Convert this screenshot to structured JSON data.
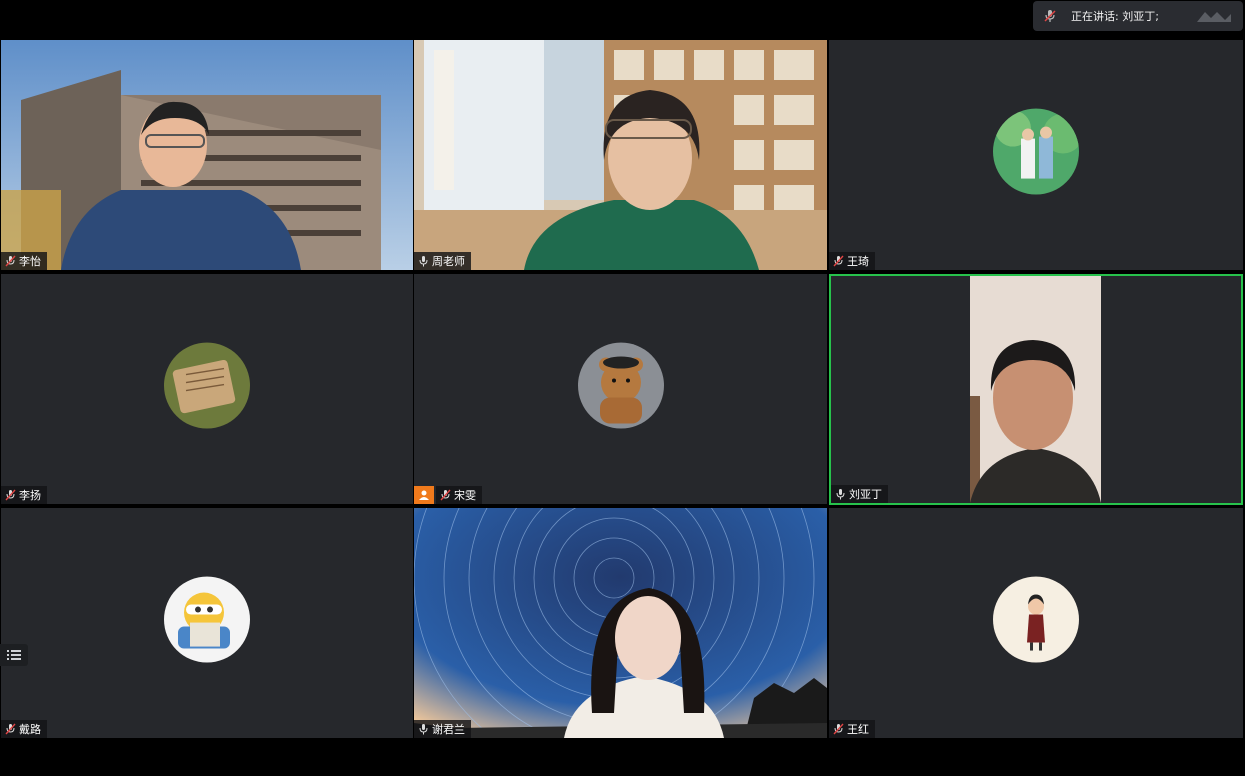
{
  "speaking_indicator": {
    "label": "正在讲话: 刘亚丁;"
  },
  "participants": [
    {
      "name": "李怡",
      "mic": "muted",
      "view": "video"
    },
    {
      "name": "周老师",
      "mic": "on",
      "view": "video"
    },
    {
      "name": "王琦",
      "mic": "muted",
      "view": "avatar"
    },
    {
      "name": "李扬",
      "mic": "muted",
      "view": "avatar"
    },
    {
      "name": "宋雯",
      "mic": "muted",
      "view": "avatar",
      "role_badge": "host-icon"
    },
    {
      "name": "刘亚丁",
      "mic": "on",
      "view": "video",
      "active_speaker": true
    },
    {
      "name": "戴路",
      "mic": "muted",
      "view": "avatar"
    },
    {
      "name": "谢君兰",
      "mic": "on",
      "view": "video"
    },
    {
      "name": "王红",
      "mic": "muted",
      "view": "avatar"
    }
  ],
  "colors": {
    "tile_bg": "#26282c",
    "active_border": "#27c24c",
    "muted_mic": "#e04545",
    "host_badge": "#f07a1c"
  }
}
